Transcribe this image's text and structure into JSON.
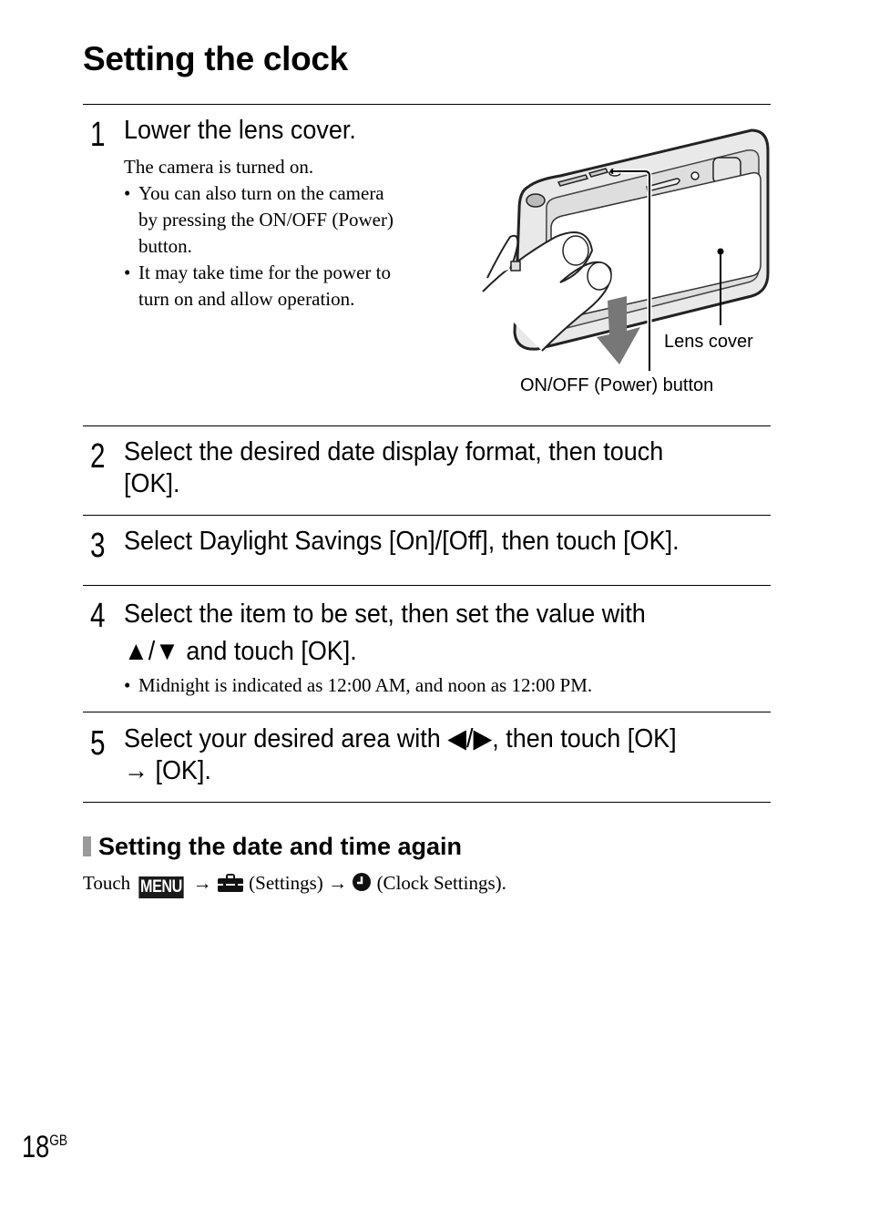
{
  "page": {
    "title": "Setting the clock",
    "page_number": "18",
    "page_suffix": "GB"
  },
  "steps": [
    {
      "number": "1",
      "heading": "Lower the lens cover.",
      "body": "The camera is turned on.",
      "bullets": [
        [
          "You can also turn on the camera",
          "by pressing the ON/OFF (Power)",
          "button."
        ],
        [
          "It may take time for the power to",
          "turn on and allow operation."
        ]
      ]
    },
    {
      "number": "2",
      "heading_lines": [
        "Select the desired date display format, then touch",
        "[OK]."
      ]
    },
    {
      "number": "3",
      "heading": "Select Daylight Savings [On]/[Off], then touch [OK]."
    },
    {
      "number": "4",
      "heading_lines": [
        "Select the item to be set, then set the value with",
        "▲/▼ and touch [OK]."
      ],
      "note": "Midnight is indicated as 12:00 AM, and noon as 12:00 PM."
    },
    {
      "number": "5",
      "heading_lines": [
        "Select your desired area with ◀/▶, then touch [OK]",
        "→ [OK]."
      ]
    }
  ],
  "illustration": {
    "callouts": {
      "lens_cover": "Lens cover",
      "power_button": "ON/OFF (Power) button"
    }
  },
  "subsection": {
    "heading": "Setting the date and time again",
    "touch_label": "Touch",
    "menu_label": "MENU",
    "arrow": "→",
    "settings_label": "(Settings)",
    "clock_label": "(Clock Settings)."
  }
}
